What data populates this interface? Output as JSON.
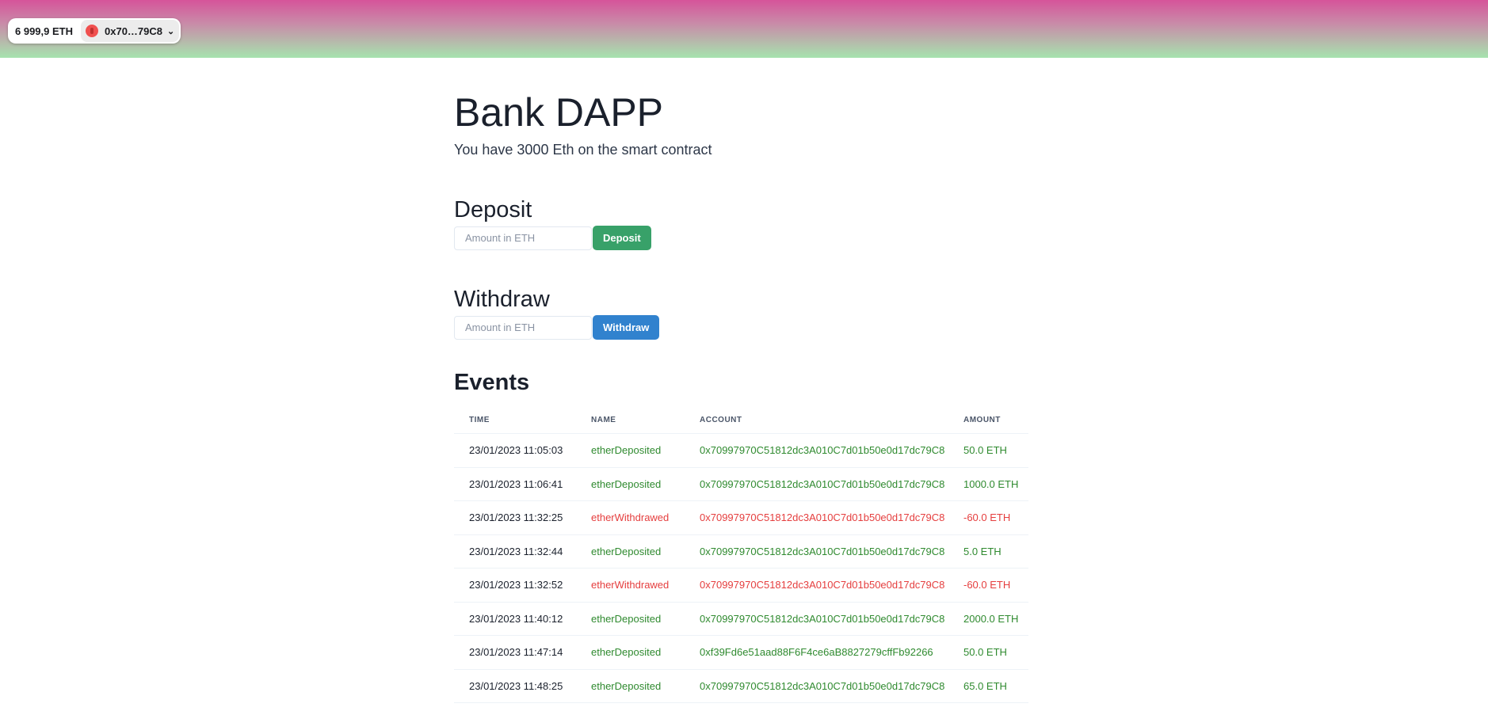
{
  "wallet": {
    "balance": "6 999,9 ETH",
    "account": "0x70…79C8",
    "chevron": "⌄",
    "avatar_icon": "red-circle-avatar-icon"
  },
  "page": {
    "title": "Bank DAPP",
    "subtitle": "You have 3000 Eth on the smart contract"
  },
  "deposit": {
    "title": "Deposit",
    "placeholder": "Amount in ETH",
    "button_label": "Deposit"
  },
  "withdraw": {
    "title": "Withdraw",
    "placeholder": "Amount in ETH",
    "button_label": "Withdraw"
  },
  "events": {
    "title": "Events",
    "columns": [
      "TIME",
      "NAME",
      "ACCOUNT",
      "AMOUNT"
    ],
    "colors": {
      "deposited": "#2f8a2f",
      "withdrawed": "#e53e3e"
    },
    "rows": [
      {
        "time": "23/01/2023 11:05:03",
        "name": "etherDeposited",
        "account": "0x70997970C51812dc3A010C7d01b50e0d17dc79C8",
        "amount": "50.0 ETH",
        "kind": "deposit"
      },
      {
        "time": "23/01/2023 11:06:41",
        "name": "etherDeposited",
        "account": "0x70997970C51812dc3A010C7d01b50e0d17dc79C8",
        "amount": "1000.0 ETH",
        "kind": "deposit"
      },
      {
        "time": "23/01/2023 11:32:25",
        "name": "etherWithdrawed",
        "account": "0x70997970C51812dc3A010C7d01b50e0d17dc79C8",
        "amount": "-60.0 ETH",
        "kind": "withdraw"
      },
      {
        "time": "23/01/2023 11:32:44",
        "name": "etherDeposited",
        "account": "0x70997970C51812dc3A010C7d01b50e0d17dc79C8",
        "amount": "5.0 ETH",
        "kind": "deposit"
      },
      {
        "time": "23/01/2023 11:32:52",
        "name": "etherWithdrawed",
        "account": "0x70997970C51812dc3A010C7d01b50e0d17dc79C8",
        "amount": "-60.0 ETH",
        "kind": "withdraw"
      },
      {
        "time": "23/01/2023 11:40:12",
        "name": "etherDeposited",
        "account": "0x70997970C51812dc3A010C7d01b50e0d17dc79C8",
        "amount": "2000.0 ETH",
        "kind": "deposit"
      },
      {
        "time": "23/01/2023 11:47:14",
        "name": "etherDeposited",
        "account": "0xf39Fd6e51aad88F6F4ce6aB8827279cffFb92266",
        "amount": "50.0 ETH",
        "kind": "deposit"
      },
      {
        "time": "23/01/2023 11:48:25",
        "name": "etherDeposited",
        "account": "0x70997970C51812dc3A010C7d01b50e0d17dc79C8",
        "amount": "65.0 ETH",
        "kind": "deposit"
      }
    ]
  }
}
